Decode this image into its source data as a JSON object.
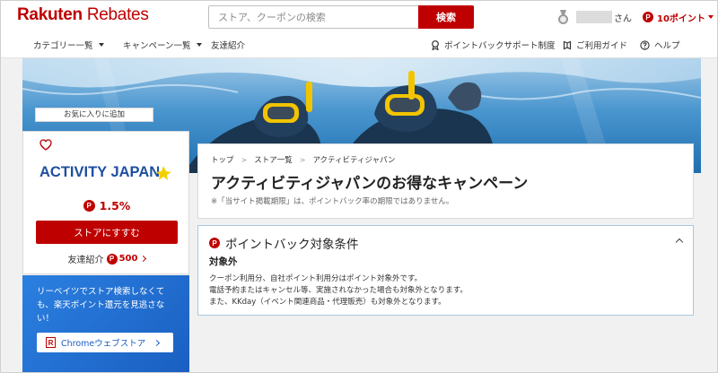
{
  "header": {
    "logo_bold": "Rakuten",
    "logo_thin": " Rebates",
    "search_placeholder": "ストア、クーポンの検索",
    "search_button": "検索",
    "honorific": "さん",
    "points": "10ポイント"
  },
  "subnav": {
    "left": [
      "カテゴリー一覧",
      "キャンペーン一覧",
      "友達紹介"
    ],
    "right": [
      "ポイントバックサポート制度",
      "ご利用ガイド",
      "ヘルプ"
    ]
  },
  "store": {
    "fav_label": "お気に入りに追加",
    "logo_text": "ACTIVITY JAPAN",
    "rate": "1.5%",
    "shop_button": "ストアにすすむ",
    "referral_label": "友達紹介",
    "referral_value": "500"
  },
  "promo": {
    "text": "リーベイツでストア検索しなくても、楽天ポイント還元を見逃さない！",
    "button": "Chromeウェブストア"
  },
  "title_panel": {
    "breadcrumb": [
      "トップ",
      "ストア一覧",
      "アクティビティジャパン"
    ],
    "title": "アクティビティジャパンのお得なキャンペーン",
    "note": "※「当サイト掲載期限」は、ポイントバック率の期限ではありません。"
  },
  "conditions": {
    "title": "ポイントバック対象条件",
    "label": "対象外",
    "lines": [
      "クーポン利用分、自社ポイント利用分はポイント対象外です。",
      "電話予約またはキャンセル等、実施されなかった場合も対象外となります。",
      "また、KKday（イベント関連商品・代理販売）も対象外となります。"
    ]
  },
  "icons": {
    "point": "P",
    "rakuten_r": "R"
  },
  "colors": {
    "brand_red": "#bf0000",
    "promo_blue": "#1a5fc2",
    "panel_border_blue": "#a9c9de"
  }
}
